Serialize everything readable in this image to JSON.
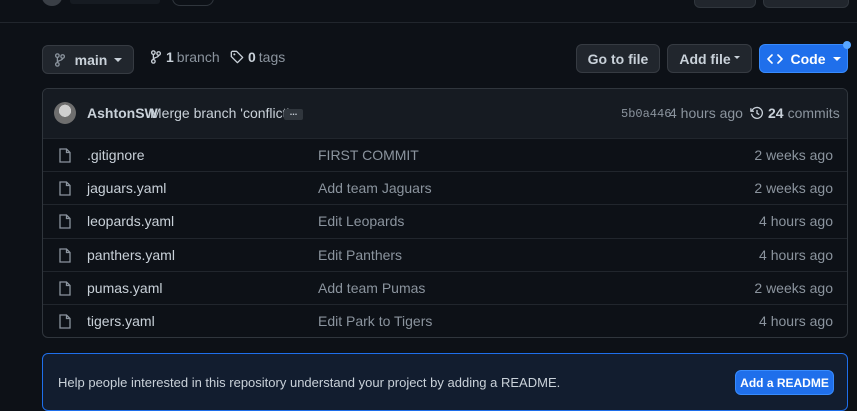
{
  "colors": {
    "background": "#0d1117",
    "accent": "#1f6feb",
    "border": "#30363d",
    "muted_text": "#8b949e"
  },
  "branch_selector": {
    "label": "main",
    "icon": "git-branch-icon"
  },
  "branches": {
    "count": "1",
    "label": "branch",
    "icon": "git-branch-icon"
  },
  "tags": {
    "count": "0",
    "label": "tags",
    "icon": "tag-icon"
  },
  "actions": {
    "go_to_file": "Go to file",
    "add_file": "Add file",
    "code": "Code",
    "code_icon": "code-icon"
  },
  "latest_commit": {
    "author": "AshtonSW",
    "message": "Merge branch 'conflict'",
    "ellipsis": "...",
    "hash": "5b0a446",
    "time": "4 hours ago",
    "commits_count": "24",
    "commits_label": "commits",
    "history_icon": "history-icon"
  },
  "files": [
    {
      "name": ".gitignore",
      "commit": "FIRST COMMIT",
      "age": "2 weeks ago",
      "icon": "file-icon"
    },
    {
      "name": "jaguars.yaml",
      "commit": "Add team Jaguars",
      "age": "2 weeks ago",
      "icon": "file-icon"
    },
    {
      "name": "leopards.yaml",
      "commit": "Edit Leopards",
      "age": "4 hours ago",
      "icon": "file-icon"
    },
    {
      "name": "panthers.yaml",
      "commit": "Edit Panthers",
      "age": "4 hours ago",
      "icon": "file-icon"
    },
    {
      "name": "pumas.yaml",
      "commit": "Add team Pumas",
      "age": "2 weeks ago",
      "icon": "file-icon"
    },
    {
      "name": "tigers.yaml",
      "commit": "Edit Park to Tigers",
      "age": "4 hours ago",
      "icon": "file-icon"
    }
  ],
  "readme_banner": {
    "text": "Help people interested in this repository understand your project by adding a README.",
    "button": "Add a README"
  }
}
